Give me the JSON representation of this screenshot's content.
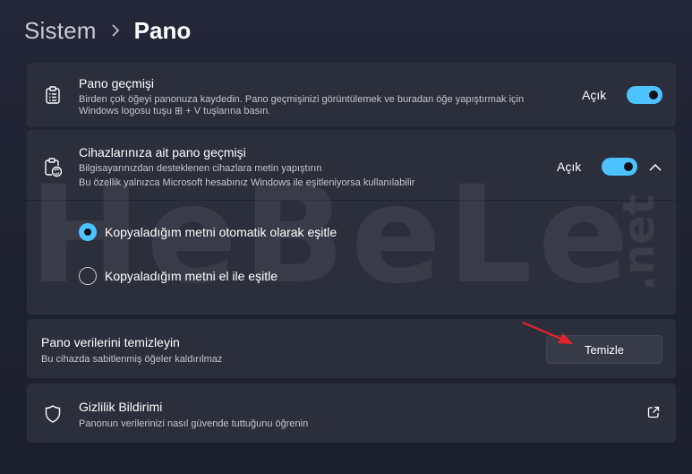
{
  "breadcrumb": {
    "parent": "Sistem",
    "current": "Pano"
  },
  "clipboard_history": {
    "title": "Pano geçmişi",
    "description_line1": "Birden çok öğeyi panonuza kaydedin. Pano geçmişinizi görüntülemek ve buradan öğe yapıştırmak için",
    "description_line2": "Windows logosu tuşu ⊞ + V tuşlarına basın.",
    "toggle_label": "Açık",
    "toggle_on": true
  },
  "device_sync": {
    "title": "Cihazlarınıza ait pano geçmişi",
    "description_line1": "Bilgisayarınızdan desteklenen cihazlara metin yapıştırın",
    "description_line2": "Bu özellik yalnızca Microsoft hesabınız Windows ile eşitleniyorsa kullanılabilir",
    "toggle_label": "Açık",
    "toggle_on": true,
    "expanded": true,
    "options": [
      {
        "label": "Kopyaladığım metni otomatik olarak eşitle",
        "selected": true
      },
      {
        "label": "Kopyaladığım metni el ile eşitle",
        "selected": false
      }
    ]
  },
  "clear_data": {
    "title": "Pano verilerini temizleyin",
    "description": "Bu cihazda sabitlenmiş öğeler kaldırılmaz",
    "button_label": "Temizle"
  },
  "privacy": {
    "title": "Gizlilik Bildirimi",
    "description": "Panonun verilerinizi nasıl güvende tuttuğunu öğrenin"
  },
  "watermark": {
    "main": "HeBeLe",
    "side": ".net"
  },
  "colors": {
    "accent": "#4cc2ff",
    "background": "#1f2230",
    "card": "#2b2e3b",
    "annotation_arrow": "#e8202a"
  }
}
